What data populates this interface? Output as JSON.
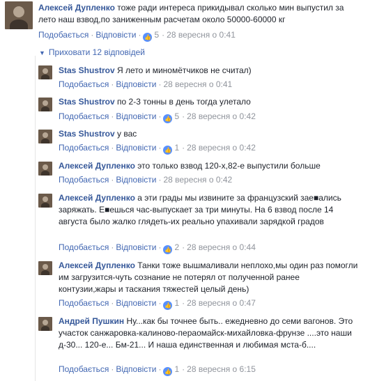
{
  "actions": {
    "like": "Подобається",
    "reply": "Відповісти"
  },
  "main_comment": {
    "author": "Алексей Дупленко",
    "text": "тоже ради интереса прикидывал сколько мин выпустил за лето наш взвод,по заниженным расчетам около 50000-60000 кг",
    "likes": "5",
    "time": "28 вересня о 0:41"
  },
  "hide_replies": "Приховати 12 відповідей",
  "replies": [
    {
      "author": "Stas Shustrov",
      "text": "Я лето и миномётчиков не считал)",
      "likes": "",
      "time": "28 вересня о 0:41"
    },
    {
      "author": "Stas Shustrov",
      "text": "по 2-3 тонны в день тогда улетало",
      "likes": "5",
      "time": "28 вересня о 0:42"
    },
    {
      "author": "Stas Shustrov",
      "text": "у вас",
      "likes": "1",
      "time": "28 вересня о 0:42"
    },
    {
      "author": "Алексей Дупленко",
      "text": "это только взвод 120-х,82-е выпустили больше",
      "likes": "",
      "time": "28 вересня о 0:42"
    },
    {
      "author": "Алексей Дупленко",
      "text": "а эти грады мы извините за французский зае■ались заряжать. Е■ешься час-выпускает за три минуты. На 6 взвод после 14 августа было жалко глядеть-их реально упахивали зарядкой градов",
      "likes": "2",
      "time": "28 вересня о 0:44"
    },
    {
      "author": "Алексей Дупленко",
      "text": "Танки тоже вышмаливали неплохо,мы один раз помогли им загрузится-чуть сознание не потерял от полученной ранее контузии,жары и таскания тяжестей целый день)",
      "likes": "1",
      "time": "28 вересня о 0:47"
    },
    {
      "author": "Андрей Пушкин",
      "text": "Ну...как бы точнее быть.. ежедневно до семи вагонов. Это участок санжаровка-калиново-пераомайск-михайловка-фрунзе ....это наши д-30... 120-е... Бм-21... И наша единственная и любимая мста-б....",
      "likes": "1",
      "time": "28 вересня о 6:15"
    }
  ]
}
